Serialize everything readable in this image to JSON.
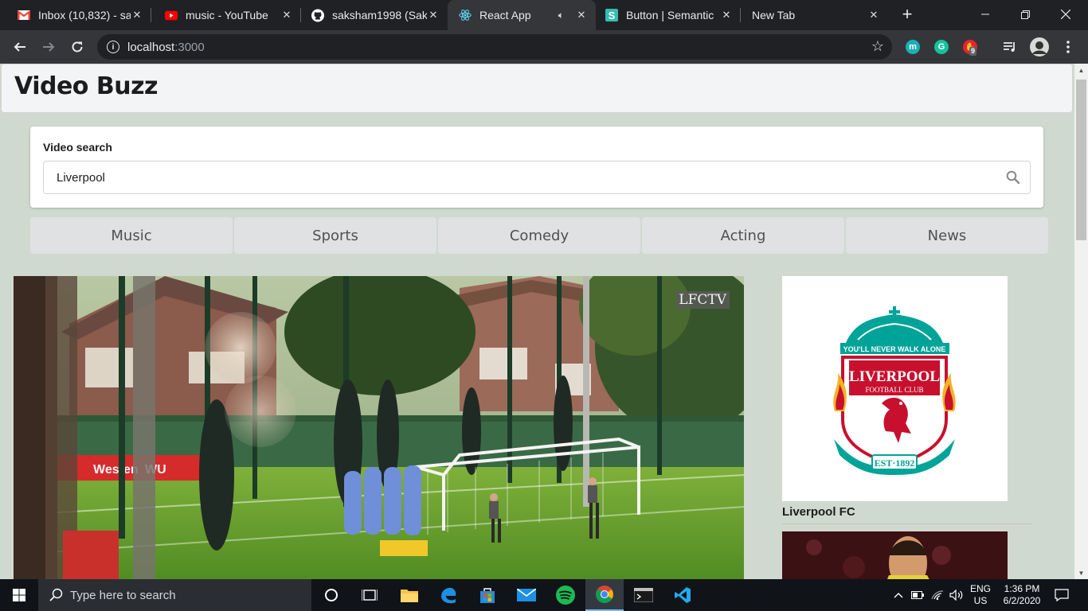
{
  "browser": {
    "tabs": [
      {
        "title": "Inbox (10,832) - sa",
        "icon": "gmail-icon",
        "active": false
      },
      {
        "title": "music - YouTube",
        "icon": "youtube-icon",
        "active": false
      },
      {
        "title": "saksham1998 (Sak",
        "icon": "github-icon",
        "active": false
      },
      {
        "title": "React App",
        "icon": "react-icon",
        "active": true
      },
      {
        "title": "Button | Semantic",
        "icon": "semantic-ui-icon",
        "active": false
      },
      {
        "title": "New Tab",
        "icon": "",
        "active": false
      }
    ],
    "url_host": "localhost",
    "url_port": ":3000",
    "extensions": [
      {
        "name": "mention-icon",
        "label": "m",
        "color": "#1ab0b5"
      },
      {
        "name": "grammarly-icon",
        "label": "G",
        "color": "#15c39a"
      },
      {
        "name": "adblock-icon",
        "label": "✋",
        "color": "#e8232f",
        "badge": "9"
      }
    ]
  },
  "app": {
    "title": "Video Buzz",
    "search": {
      "label": "Video search",
      "value": "Liverpool"
    },
    "categories": [
      "Music",
      "Sports",
      "Comedy",
      "Acting",
      "News"
    ],
    "player": {
      "watermark": "LFCTV"
    },
    "videos": [
      {
        "title": "Liverpool FC"
      }
    ]
  },
  "taskbar": {
    "search_placeholder": "Type here to search",
    "language": "ENG",
    "region": "US",
    "time": "1:36 PM",
    "date": "6/2/2020"
  },
  "colors": {
    "page_bg": "#d0d9cf",
    "chrome_dark": "#202124",
    "chrome_toolbar": "#35363a",
    "lfc_red": "#c8102e",
    "lfc_green": "#00a398"
  }
}
